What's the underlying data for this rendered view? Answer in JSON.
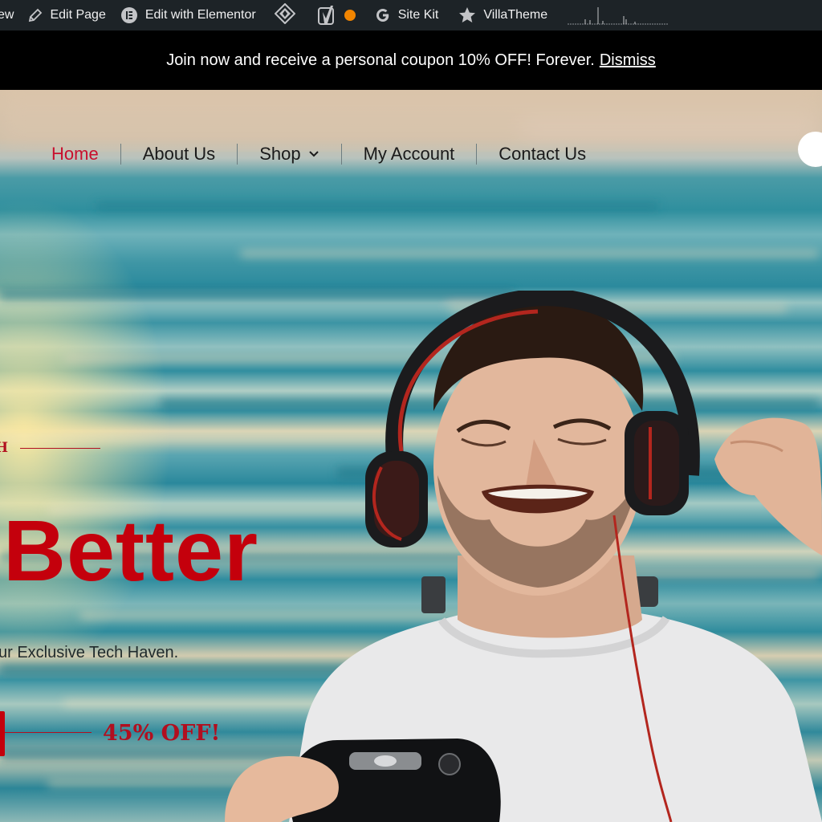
{
  "adminbar": {
    "view_label": "ew",
    "edit_page_label": "Edit Page",
    "elementor_label": "Edit with Elementor",
    "sitekit_label": "Site Kit",
    "villatheme_label": "VillaTheme",
    "status_dot_color": "#f18500"
  },
  "notice": {
    "message": "Join now and receive a personal coupon 10% OFF! Forever.",
    "dismiss_label": "Dismiss"
  },
  "nav": {
    "items": [
      {
        "label": "Home",
        "active": true
      },
      {
        "label": "About Us"
      },
      {
        "label": "Shop"
      },
      {
        "label": "My Account"
      },
      {
        "label": "Contact Us"
      }
    ]
  },
  "hero": {
    "eyebrow": "H",
    "headline": "Better",
    "subline": "ur Exclusive Tech Haven.",
    "offer": "45% OFF!"
  },
  "colors": {
    "accent": "#c4000c",
    "adminbar_bg": "#1d2327",
    "notice_bg": "#000000"
  }
}
